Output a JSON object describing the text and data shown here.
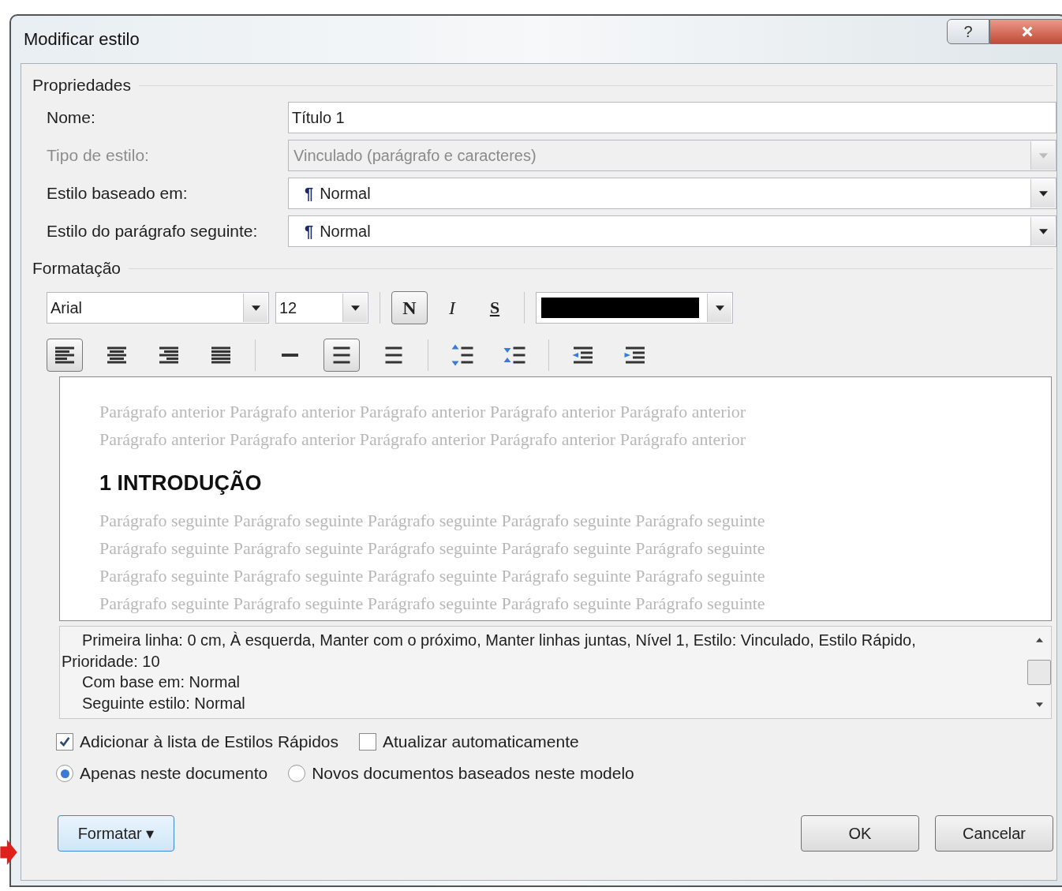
{
  "window": {
    "title": "Modificar estilo",
    "help_glyph": "?"
  },
  "properties": {
    "heading": "Propriedades",
    "fields": [
      {
        "label": "Nome:",
        "kind": "text",
        "value": "Título 1",
        "disabled": false
      },
      {
        "label": "Tipo de estilo:",
        "kind": "combo",
        "value": "Vinculado (parágrafo e caracteres)",
        "disabled": true
      },
      {
        "label": "Estilo baseado em:",
        "kind": "combo",
        "marker": "¶",
        "value": "Normal",
        "disabled": false
      },
      {
        "label": "Estilo do parágrafo seguinte:",
        "kind": "combo",
        "marker": "¶",
        "value": "Normal",
        "disabled": false
      }
    ]
  },
  "formatting": {
    "heading": "Formatação",
    "font": "Arial",
    "size": "12",
    "styles": [
      {
        "glyph": "N",
        "kind": "bold",
        "selected": true
      },
      {
        "glyph": "I",
        "kind": "italic",
        "selected": false
      },
      {
        "glyph": "S",
        "kind": "underline",
        "selected": false
      }
    ],
    "color": "#000000",
    "tool_groups": [
      [
        {
          "kind": "align-left",
          "selected": true
        },
        {
          "kind": "align-center",
          "selected": false
        },
        {
          "kind": "align-right",
          "selected": false
        },
        {
          "kind": "justify",
          "selected": false
        }
      ],
      [
        {
          "kind": "single-spacing",
          "selected": false
        },
        {
          "kind": "one-half-spacing",
          "selected": true
        },
        {
          "kind": "double-spacing",
          "selected": false
        }
      ],
      [
        {
          "kind": "spacing-increase",
          "selected": false
        },
        {
          "kind": "spacing-decrease",
          "selected": false
        }
      ],
      [
        {
          "kind": "indent-decrease",
          "selected": false
        },
        {
          "kind": "indent-increase",
          "selected": false
        }
      ]
    ]
  },
  "preview": {
    "before": [
      "Parágrafo anterior Parágrafo anterior Parágrafo anterior Parágrafo anterior Parágrafo anterior",
      "Parágrafo anterior Parágrafo anterior Parágrafo anterior Parágrafo anterior Parágrafo anterior"
    ],
    "heading": "1 INTRODUÇÃO",
    "after": [
      "Parágrafo seguinte Parágrafo seguinte Parágrafo seguinte Parágrafo seguinte Parágrafo seguinte",
      "Parágrafo seguinte Parágrafo seguinte Parágrafo seguinte Parágrafo seguinte Parágrafo seguinte",
      "Parágrafo seguinte Parágrafo seguinte Parágrafo seguinte Parágrafo seguinte Parágrafo seguinte",
      "Parágrafo seguinte Parágrafo seguinte Parágrafo seguinte Parágrafo seguinte Parágrafo seguinte"
    ]
  },
  "description": [
    "Primeira linha:  0 cm, À esquerda, Manter com o próximo, Manter linhas juntas, Nível 1, Estilo: Vinculado, Estilo Rápido, Prioridade: 10",
    "Com base em: Normal",
    "Seguinte estilo: Normal"
  ],
  "options": [
    {
      "label": "Adicionar à lista de Estilos Rápidos",
      "checked": true
    },
    {
      "label": "Atualizar automaticamente",
      "checked": false
    }
  ],
  "scope": [
    {
      "label": "Apenas neste documento",
      "selected": true
    },
    {
      "label": "Novos documentos baseados neste modelo",
      "selected": false
    }
  ],
  "buttons": {
    "format": "Formatar",
    "format_caret": "▾",
    "ok": "OK",
    "cancel": "Cancelar"
  }
}
